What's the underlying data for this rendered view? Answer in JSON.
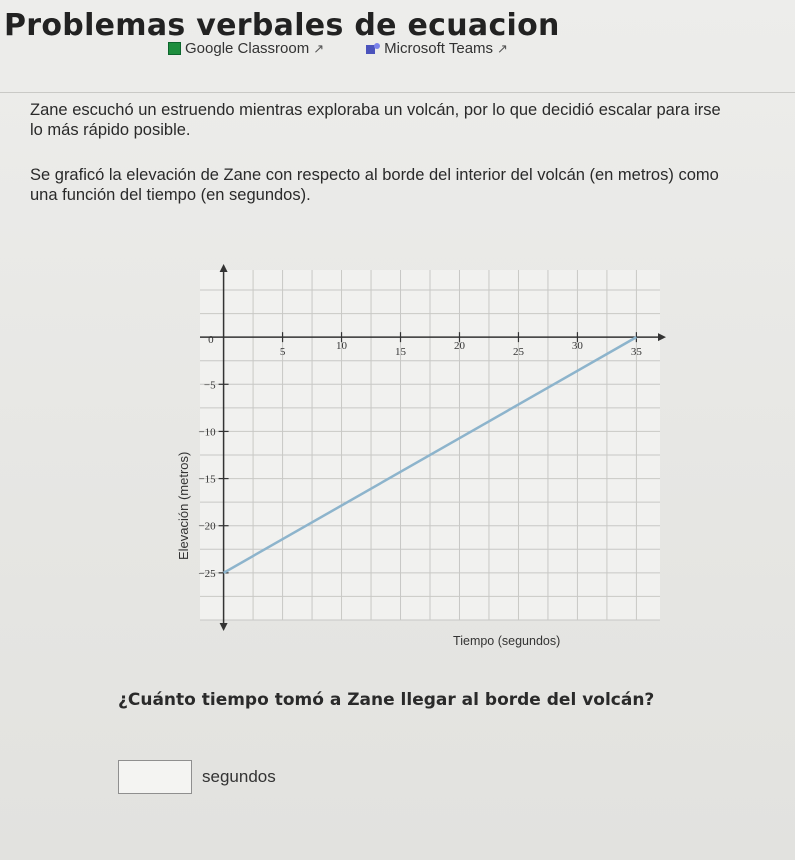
{
  "header": {
    "title": "Problemas verbales de ecuacion",
    "links": [
      {
        "label": "Google Classroom",
        "icon": "google-classroom-icon"
      },
      {
        "label": "Microsoft Teams",
        "icon": "microsoft-teams-icon"
      }
    ],
    "external_glyph": "↗"
  },
  "problem": {
    "paragraph1": "Zane escuchó un estruendo mientras exploraba un volcán, por lo que decidió escalar para irse lo más rápido posible.",
    "paragraph2": "Se graficó la elevación de Zane con respecto al borde del interior del volcán (en metros) como una función del tiempo (en segundos).",
    "question": "¿Cuánto tiempo tomó a Zane llegar al borde del volcán?",
    "answer": {
      "value": "",
      "placeholder": "",
      "unit": "segundos"
    }
  },
  "chart_data": {
    "type": "line",
    "xlabel": "Tiempo (segundos)",
    "ylabel": "Elevación (metros)",
    "x_ticks": [
      "5",
      "10",
      "15",
      "20",
      "25",
      "30",
      "35"
    ],
    "y_ticks": [
      "0",
      "−5",
      "−10",
      "−15",
      "−20",
      "−25"
    ],
    "origin_label": "0",
    "xlim": [
      -2,
      37
    ],
    "ylim": [
      -30,
      5
    ],
    "grid": true,
    "line_color": "#8db4cc",
    "series": [
      {
        "x": [
          0,
          35
        ],
        "y": [
          -25,
          0
        ]
      }
    ]
  }
}
